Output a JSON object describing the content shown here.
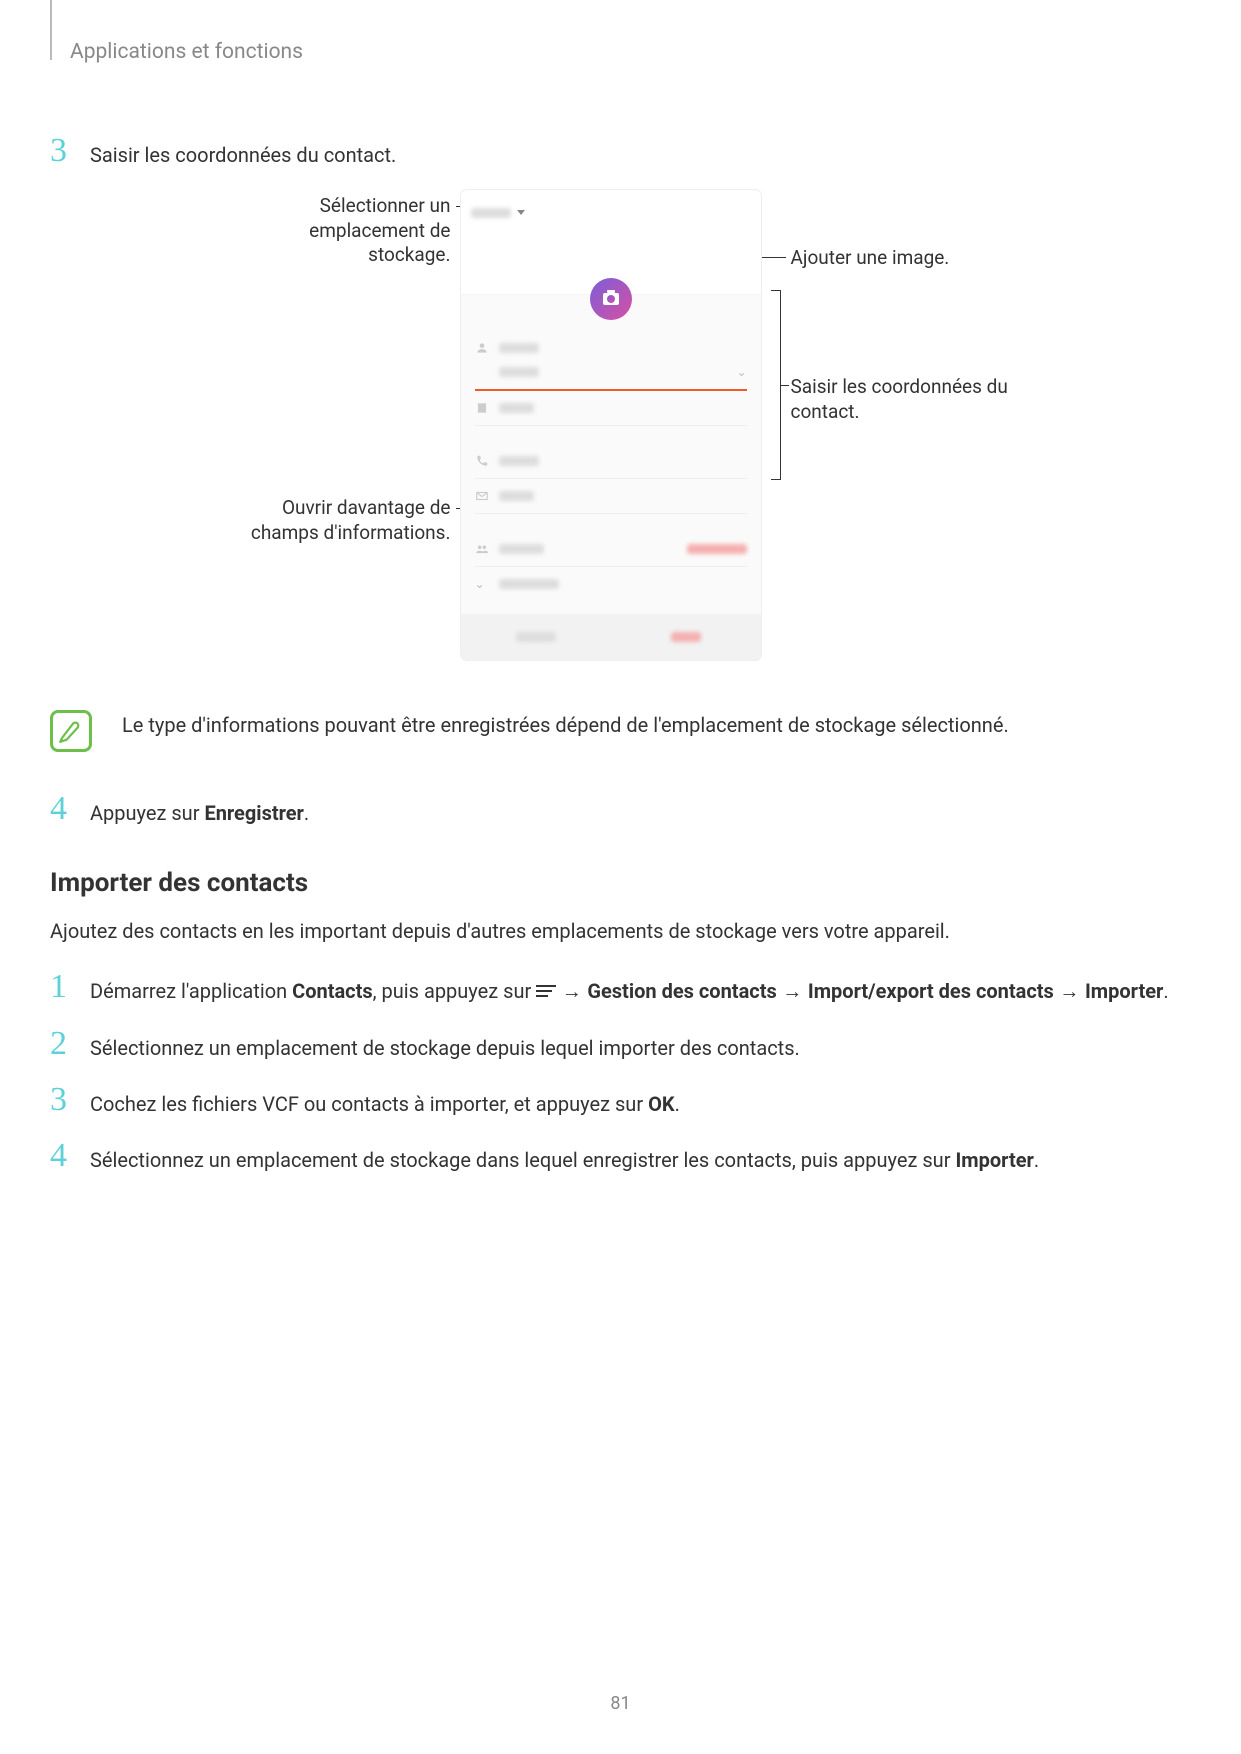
{
  "header": {
    "title": "Applications et fonctions"
  },
  "step3": {
    "num": "3",
    "text": "Saisir les coordonnées du contact."
  },
  "diagram": {
    "callout_storage": "Sélectionner un emplacement de stockage.",
    "callout_image": "Ajouter une image.",
    "callout_fields": "Saisir les coordonnées du contact.",
    "callout_more": "Ouvrir davantage de champs d'informations.",
    "mock": {
      "storage_label": "Phone",
      "name1": "Name",
      "name2": "Name",
      "work": "Work",
      "phone": "Phone",
      "email": "Email",
      "groups": "Groups",
      "not_assigned": "Not assigned",
      "view_more": "View more",
      "cancel": "Cancel",
      "save": "Save"
    }
  },
  "note": {
    "text": "Le type d'informations pouvant être enregistrées dépend de l'emplacement de stockage sélectionné."
  },
  "step4": {
    "num": "4",
    "prefix": "Appuyez sur ",
    "bold": "Enregistrer",
    "suffix": "."
  },
  "import_section": {
    "title": "Importer des contacts",
    "intro": "Ajoutez des contacts en les important depuis d'autres emplacements de stockage vers votre appareil.",
    "s1": {
      "num": "1",
      "p1": "Démarrez l'application ",
      "b1": "Contacts",
      "p2": ", puis appuyez sur ",
      "arrow": " → ",
      "b2": "Gestion des contacts",
      "b3": "Import/export des contacts",
      "b4": "Importer",
      "p3": "."
    },
    "s2": {
      "num": "2",
      "text": "Sélectionnez un emplacement de stockage depuis lequel importer des contacts."
    },
    "s3": {
      "num": "3",
      "p1": "Cochez les fichiers VCF ou contacts à importer, et appuyez sur ",
      "b1": "OK",
      "p2": "."
    },
    "s4": {
      "num": "4",
      "p1": "Sélectionnez un emplacement de stockage dans lequel enregistrer les contacts, puis appuyez sur ",
      "b1": "Importer",
      "p2": "."
    }
  },
  "page_number": "81"
}
